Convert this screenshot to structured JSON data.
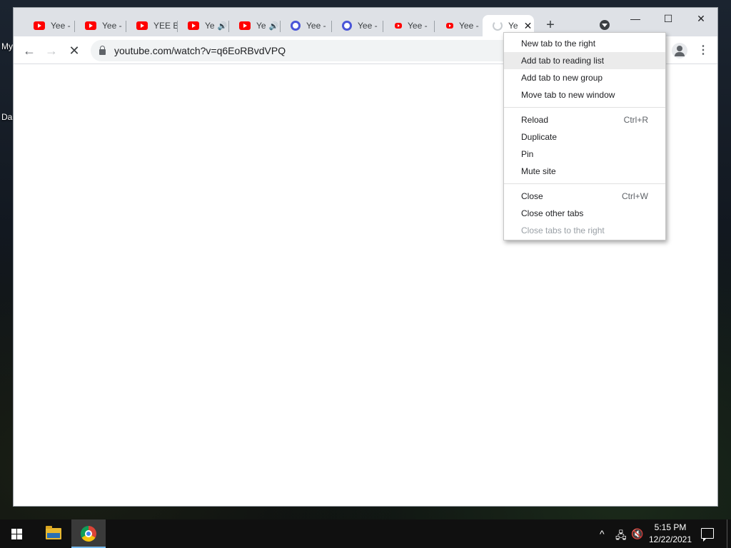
{
  "desktop": {
    "labels": [
      "My",
      "Da"
    ]
  },
  "browser": {
    "tabs": [
      {
        "title": "Yee -",
        "favicon": "youtube-icon",
        "audio": false
      },
      {
        "title": "Yee -",
        "favicon": "youtube-icon",
        "audio": false
      },
      {
        "title": "YEE B",
        "favicon": "youtube-icon",
        "audio": false
      },
      {
        "title": "Ye",
        "favicon": "youtube-icon",
        "audio": true
      },
      {
        "title": "Ye",
        "favicon": "youtube-icon",
        "audio": true
      },
      {
        "title": "Yee -",
        "favicon": "round-icon",
        "audio": false
      },
      {
        "title": "Yee -",
        "favicon": "round-icon",
        "audio": false
      },
      {
        "title": "Yee -",
        "favicon": "youtube-small-icon",
        "audio": false
      },
      {
        "title": "Yee -",
        "favicon": "youtube-small-icon",
        "audio": false
      },
      {
        "title": "Ye",
        "favicon": "loading-spinner",
        "audio": false,
        "active": true
      }
    ],
    "audio_glyph": "🔊",
    "close_glyph": "✕",
    "newtab_glyph": "+",
    "window_controls": {
      "minimize": "—",
      "maximize": "☐",
      "close": "✕"
    },
    "toolbar": {
      "back_glyph": "←",
      "forward_glyph": "→",
      "stop_glyph": "✕",
      "url": "youtube.com/watch?v=q6EoRBvdVPQ",
      "menu_glyph": "⋮"
    }
  },
  "context_menu": {
    "groups": [
      [
        {
          "label": "New tab to the right",
          "shortcut": "",
          "state": "normal"
        },
        {
          "label": "Add tab to reading list",
          "shortcut": "",
          "state": "hover"
        },
        {
          "label": "Add tab to new group",
          "shortcut": "",
          "state": "normal"
        },
        {
          "label": "Move tab to new window",
          "shortcut": "",
          "state": "normal"
        }
      ],
      [
        {
          "label": "Reload",
          "shortcut": "Ctrl+R",
          "state": "normal"
        },
        {
          "label": "Duplicate",
          "shortcut": "",
          "state": "normal"
        },
        {
          "label": "Pin",
          "shortcut": "",
          "state": "normal"
        },
        {
          "label": "Mute site",
          "shortcut": "",
          "state": "normal"
        }
      ],
      [
        {
          "label": "Close",
          "shortcut": "Ctrl+W",
          "state": "normal"
        },
        {
          "label": "Close other tabs",
          "shortcut": "",
          "state": "normal"
        },
        {
          "label": "Close tabs to the right",
          "shortcut": "",
          "state": "disabled"
        }
      ]
    ]
  },
  "taskbar": {
    "time": "5:15 PM",
    "date": "12/22/2021",
    "tray": {
      "chevron_glyph": "^",
      "network_glyph": "🖧",
      "volume_glyph": "🔇"
    }
  },
  "colors": {
    "tabstrip": "#dee1e6",
    "youtube_red": "#ff0000",
    "menu_hover": "#ebebeb",
    "taskbar": "#101010"
  }
}
